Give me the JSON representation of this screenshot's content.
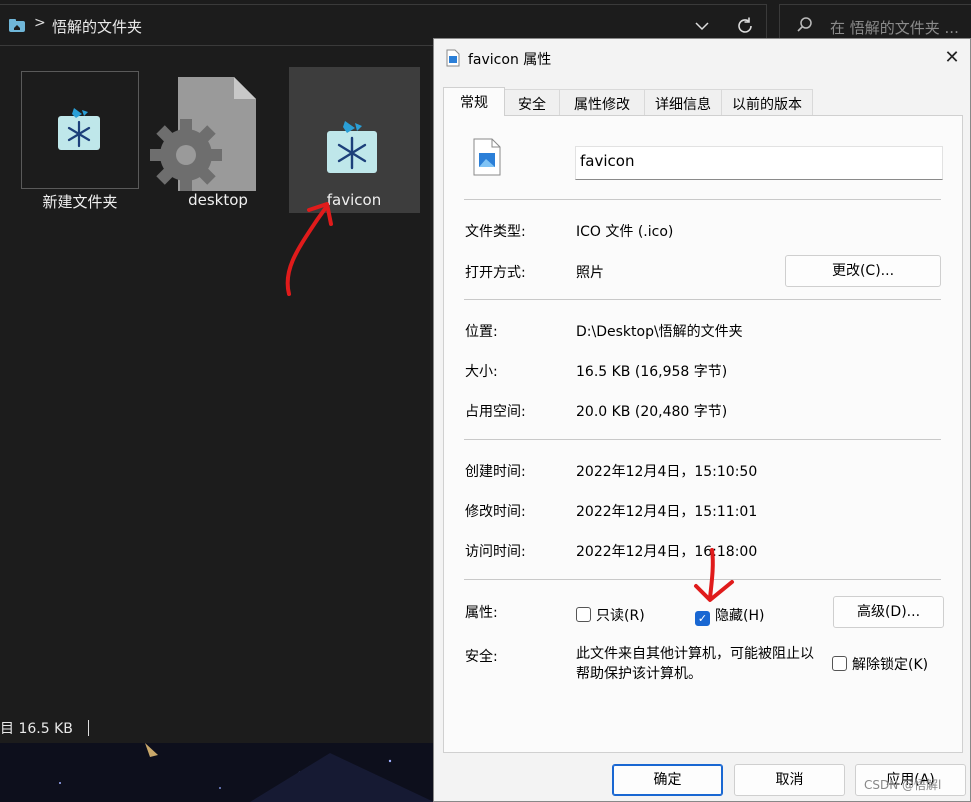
{
  "explorer": {
    "breadcrumb_sep": ">",
    "path": "悟解的文件夹",
    "search_placeholder": "在 悟解的文件夹 ...",
    "files": [
      {
        "name": "新建文件夹"
      },
      {
        "name": "desktop"
      },
      {
        "name": "favicon"
      }
    ],
    "status_text": "目  16.5 KB"
  },
  "dialog": {
    "title": "favicon 属性",
    "close": "✕",
    "tabs": [
      "常规",
      "安全",
      "属性修改",
      "详细信息",
      "以前的版本"
    ],
    "filename": "favicon",
    "file_type_label": "文件类型:",
    "file_type_value": "ICO 文件 (.ico)",
    "open_with_label": "打开方式:",
    "open_with_value": "照片",
    "change_button": "更改(C)...",
    "location_label": "位置:",
    "location_value": "D:\\Desktop\\悟解的文件夹",
    "size_label": "大小:",
    "size_value": "16.5 KB (16,958 字节)",
    "size_on_disk_label": "占用空间:",
    "size_on_disk_value": "20.0 KB (20,480 字节)",
    "created_label": "创建时间:",
    "created_value": "2022年12月4日，15:10:50",
    "modified_label": "修改时间:",
    "modified_value": "2022年12月4日，15:11:01",
    "accessed_label": "访问时间:",
    "accessed_value": "2022年12月4日，16:18:00",
    "attributes_label": "属性:",
    "readonly_label": "只读(R)",
    "readonly_checked": false,
    "hidden_label": "隐藏(H)",
    "hidden_checked": true,
    "advanced_button": "高级(D)...",
    "security_label": "安全:",
    "security_text": "此文件来自其他计算机，可能被阻止以帮助保护该计算机。",
    "unblock_label": "解除锁定(K)",
    "unblock_checked": false,
    "ok_button": "确定",
    "cancel_button": "取消",
    "apply_button": "应用(A)"
  },
  "watermark": "CSDN @悟解l",
  "colors": {
    "explorer_bg": "#1c1c1c",
    "dialog_bg": "#f3f3f3",
    "accent": "#1967d2",
    "annotation_red": "#e01b1b"
  }
}
